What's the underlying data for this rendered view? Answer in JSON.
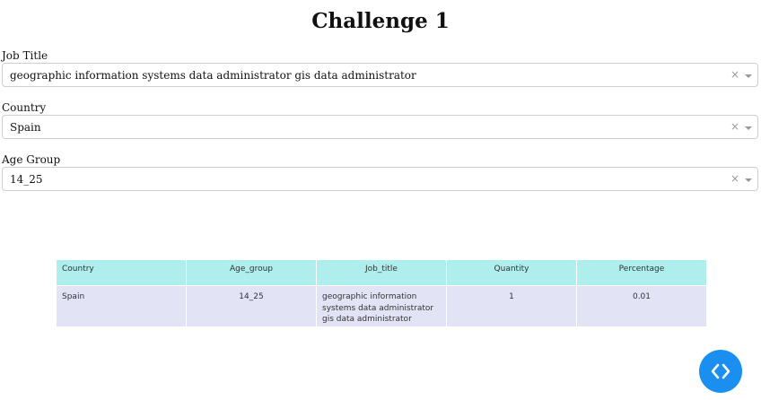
{
  "page": {
    "title": "Challenge 1"
  },
  "filters": {
    "job_title": {
      "label": "Job Title",
      "value": "geographic information systems data administrator gis data administrator"
    },
    "country": {
      "label": "Country",
      "value": "Spain"
    },
    "age_group": {
      "label": "Age Group",
      "value": "14_25"
    },
    "clear_glyph": "×"
  },
  "table": {
    "headers": [
      "Country",
      "Age_group",
      "Job_title",
      "Quantity",
      "Percentage"
    ],
    "rows": [
      [
        "Spain",
        "14_25",
        "geographic information systems data administrator gis data administrator",
        "1",
        "0.01"
      ]
    ]
  },
  "colors": {
    "header_bg": "#aeeeed",
    "row_bg": "#e3e3f6",
    "fab_bg": "#1a8ff0"
  },
  "fab": {
    "icon": "code-icon"
  }
}
